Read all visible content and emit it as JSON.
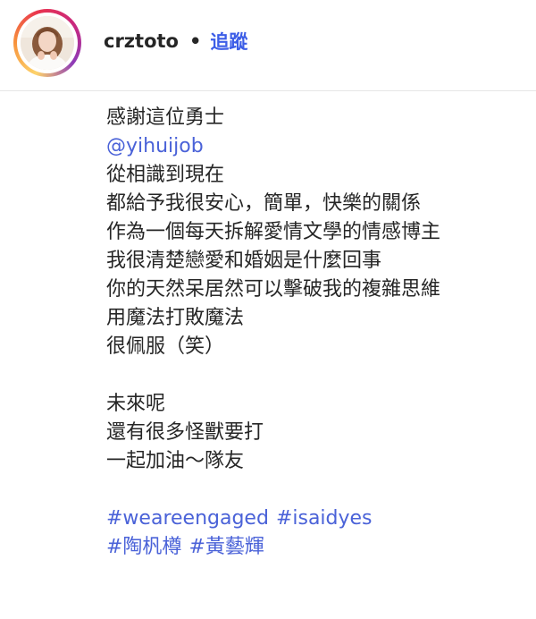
{
  "post": {
    "username": "crztoto",
    "separator": "•",
    "follow_label": "追蹤"
  },
  "caption": {
    "lines": [
      "感謝這位勇士",
      "從相識到現在",
      "都給予我很安心，簡單，快樂的關係",
      "作為一個每天拆解愛情文學的情感博主",
      "我很清楚戀愛和婚姻是什麼回事",
      "你的天然呆居然可以擊破我的複雜思維",
      "用魔法打敗魔法",
      "很佩服（笑）",
      "未來呢",
      "還有很多怪獸要打",
      "一起加油～隊友"
    ],
    "mention": "@yihuijob",
    "hashtags_row1": [
      "#weareengaged",
      "#isaidyes"
    ],
    "hashtags_row2": [
      "#陶杋樽",
      "#黃藝輝"
    ]
  },
  "colors": {
    "link": "#4a62d8",
    "follow": "#3d5ee7",
    "text": "#262626"
  }
}
